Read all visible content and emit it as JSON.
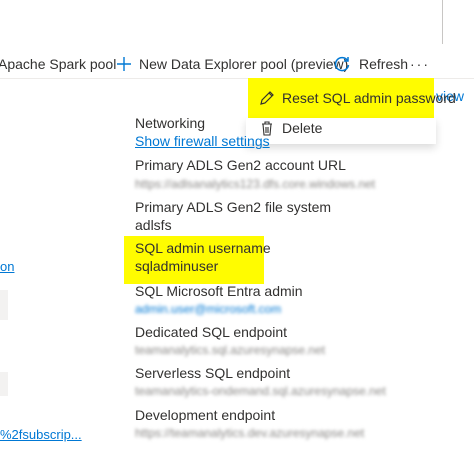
{
  "toolbar": {
    "spark_pool_label": "Apache Spark pool",
    "data_explorer_label": "New Data Explorer pool (preview)",
    "refresh_label": "Refresh",
    "more_label": "···"
  },
  "dropdown": {
    "reset_label": "Reset SQL admin password",
    "delete_label": "Delete",
    "behind_text": "view"
  },
  "properties": {
    "networking_label": "Networking",
    "networking_link": "Show firewall settings",
    "adls_account_label": "Primary ADLS Gen2 account URL",
    "adls_account_value": "https://adlsanalytics123.dfs.core.windows.net",
    "adls_fs_label": "Primary ADLS Gen2 file system",
    "adls_fs_value": "adlsfs",
    "sql_user_label": "SQL admin username",
    "sql_user_value": "sqladminuser",
    "entra_label": "SQL Microsoft Entra admin",
    "entra_value": "admin.user@microsoft.com",
    "dedicated_label": "Dedicated SQL endpoint",
    "dedicated_value": "teamanalytics.sql.azuresynapse.net",
    "serverless_label": "Serverless SQL endpoint",
    "serverless_value": "teamanalytics-ondemand.sql.azuresynapse.net",
    "dev_label": "Development endpoint",
    "dev_value": "https://teamanalytics.dev.azuresynapse.net"
  },
  "left": {
    "frag1": "on",
    "frag2": "%2fsubscrip..."
  },
  "colors": {
    "highlight": "#fffc00",
    "link": "#0078d4",
    "text": "#323130"
  },
  "icons": {
    "plus": "plus-icon",
    "refresh": "refresh-icon",
    "edit": "pencil-icon",
    "delete": "trash-icon"
  }
}
